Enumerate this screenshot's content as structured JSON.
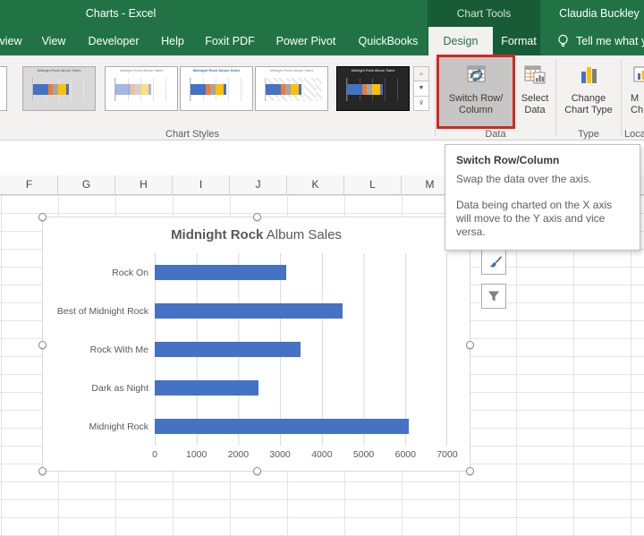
{
  "colors": {
    "excel_green": "#217346",
    "contextual_green": "#185C37",
    "ribbon_gray": "#F3F2F1",
    "highlight_red": "#D2291F",
    "bar_blue": "#4472C4"
  },
  "titlebar": {
    "document_title": "Charts  -  Excel",
    "contextual_tab_group": "Chart Tools",
    "user_name": "Claudia Buckley"
  },
  "ribbon_tabs": {
    "partial_left": "view",
    "tabs": [
      "View",
      "Developer",
      "Help",
      "Foxit PDF",
      "Power Pivot",
      "QuickBooks"
    ],
    "active_tab": "Design",
    "format_tab": "Format",
    "tell_me": "Tell me what y"
  },
  "ribbon": {
    "gallery_group_label": "Chart Styles",
    "mini_chart_title": "Midnight Rock Album Sales",
    "data_group": {
      "label": "Data",
      "switch_line1": "Switch Row/",
      "switch_line2": "Column",
      "select_line1": "Select",
      "select_line2": "Data"
    },
    "type_group": {
      "label": "Type",
      "change_line1": "Change",
      "change_line2": "Chart Type"
    },
    "location_group": {
      "label": "Loca",
      "move_line1": "M",
      "move_line2": "Ch"
    }
  },
  "tooltip": {
    "title": "Switch Row/Column",
    "body1": "Swap the data over the axis.",
    "body2": "Data being charted on the X axis will move to the Y axis and vice versa."
  },
  "sheet": {
    "column_headers": [
      "F",
      "G",
      "H",
      "I",
      "J",
      "K",
      "L",
      "M"
    ]
  },
  "chart_data": {
    "type": "bar",
    "orientation": "horizontal",
    "title_bold": "Midnight Rock",
    "title_regular": " Album Sales",
    "categories": [
      "Rock On",
      "Best of Midnight Rock",
      "Rock With Me",
      "Dark as Night",
      "Midnight Rock"
    ],
    "values": [
      3150,
      4500,
      3500,
      2500,
      6100
    ],
    "xlim": [
      0,
      7000
    ],
    "xticks": [
      "0",
      "1000",
      "2000",
      "3000",
      "4000",
      "5000",
      "6000",
      "7000"
    ],
    "bar_color": "#4472C4",
    "grid": true,
    "legend": "none"
  }
}
